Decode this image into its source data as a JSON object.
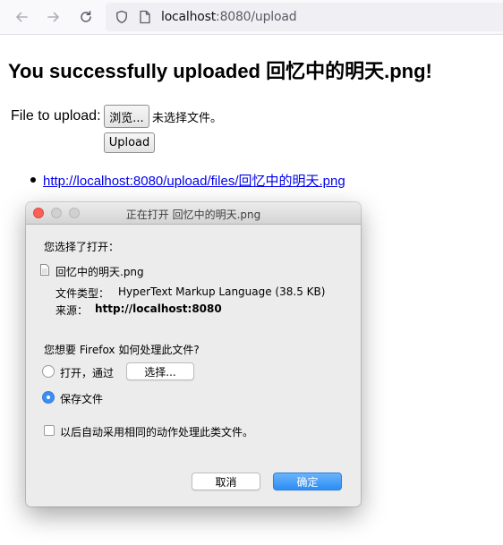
{
  "browser": {
    "url_host": "localhost",
    "url_rest": ":8080/upload"
  },
  "page": {
    "heading": "You successfully uploaded 回忆中的明天.png!",
    "upload_label": "File to upload:",
    "browse_button": "浏览...",
    "no_file_text": "未选择文件。",
    "upload_button": "Upload",
    "file_link": "http://localhost:8080/upload/files/回忆中的明天.png"
  },
  "dialog": {
    "title": "正在打开 回忆中的明天.png",
    "intro": "您选择了打开：",
    "file_name": "回忆中的明天.png",
    "type_label": "文件类型：",
    "type_value": "HyperText Markup Language (38.5 KB)",
    "source_label": "来源：",
    "source_value": "http://localhost:8080",
    "question": "您想要 Firefox 如何处理此文件?",
    "option_open": "打开，通过",
    "choose_button": "选择...",
    "option_save": "保存文件",
    "selected_option": "save",
    "auto_checkbox": "以后自动采用相同的动作处理此类文件。",
    "cancel_button": "取消",
    "ok_button": "确定"
  },
  "colors": {
    "link": "#0000ee",
    "accent": "#2a8ef6"
  }
}
